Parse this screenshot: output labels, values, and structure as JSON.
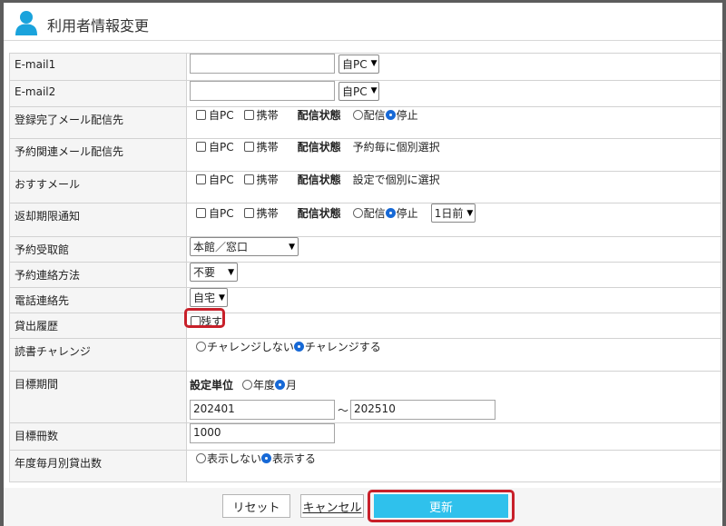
{
  "header": {
    "title": "利用者情報変更",
    "icon": "user-icon"
  },
  "email1": {
    "label": "E-mail1",
    "value": "",
    "select": "自PC"
  },
  "email2": {
    "label": "E-mail2",
    "value": "",
    "select": "自PC"
  },
  "reg_mail": {
    "label": "登録完了メール配信先",
    "opt_pc": "自PC",
    "opt_mobile": "携帯",
    "status_label": "配信状態",
    "radio_on": "配信",
    "radio_off": "停止",
    "selected": "停止"
  },
  "reserve_mail": {
    "label": "予約関連メール配信先",
    "opt_pc": "自PC",
    "opt_mobile": "携帯",
    "status_label": "配信状態",
    "status_text": "予約毎に個別選択"
  },
  "recommend_mail": {
    "label": "おすすメール",
    "opt_pc": "自PC",
    "opt_mobile": "携帯",
    "status_label": "配信状態",
    "status_text": "設定で個別に選択"
  },
  "due_notice": {
    "label": "返却期限通知",
    "opt_pc": "自PC",
    "opt_mobile": "携帯",
    "status_label": "配信状態",
    "radio_on": "配信",
    "radio_off": "停止",
    "selected": "停止",
    "days_select": "1日前"
  },
  "pickup": {
    "label": "予約受取館",
    "select": "本館／窓口"
  },
  "contact_method": {
    "label": "予約連絡方法",
    "select": "不要"
  },
  "phone": {
    "label": "電話連絡先",
    "select": "自宅"
  },
  "history": {
    "label": "貸出履歴",
    "checkbox_label": "残す",
    "checked": false
  },
  "reading_challenge": {
    "label": "読書チャレンジ",
    "opt_off": "チャレンジしない",
    "opt_on": "チャレンジする",
    "selected": "チャレンジする"
  },
  "target_period": {
    "label": "目標期間",
    "unit_label": "設定単位",
    "opt_year": "年度",
    "opt_month": "月",
    "selected": "月",
    "from": "202401",
    "separator": "～",
    "to": "202510"
  },
  "target_count": {
    "label": "目標冊数",
    "value": "1000"
  },
  "monthly_count": {
    "label": "年度毎月別貸出数",
    "opt_hide": "表示しない",
    "opt_show": "表示する",
    "selected": "表示する"
  },
  "buttons": {
    "reset": "リセット",
    "cancel": "キャンセル",
    "update": "更新"
  },
  "colors": {
    "primary": "#2fc1ec",
    "highlight": "#c8202a",
    "user_icon": "#1aa3dc"
  }
}
